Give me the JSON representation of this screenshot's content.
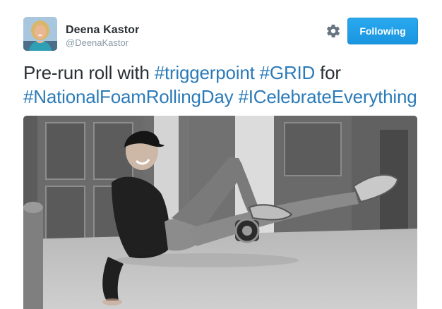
{
  "author": {
    "display_name": "Deena Kastor",
    "handle": "@DeenaKastor",
    "avatar_icon": "profile-photo"
  },
  "actions": {
    "settings_icon": "gear-icon",
    "follow_label": "Following"
  },
  "tweet": {
    "line1_prefix": "Pre-run roll with ",
    "hashtag1": "#triggerpoint",
    "line1_space": " ",
    "hashtag2": "#GRID",
    "line1_suffix": " for",
    "hashtag3": "#NationalFoamRollingDay",
    "line2_space": " ",
    "hashtag4": "#ICelebrateEverything"
  },
  "media": {
    "type": "photo",
    "style": "black-and-white"
  },
  "colors": {
    "accent": "#1da1f2",
    "hashtag": "#2b7bb9",
    "text": "#292f33",
    "muted": "#8899a6"
  }
}
